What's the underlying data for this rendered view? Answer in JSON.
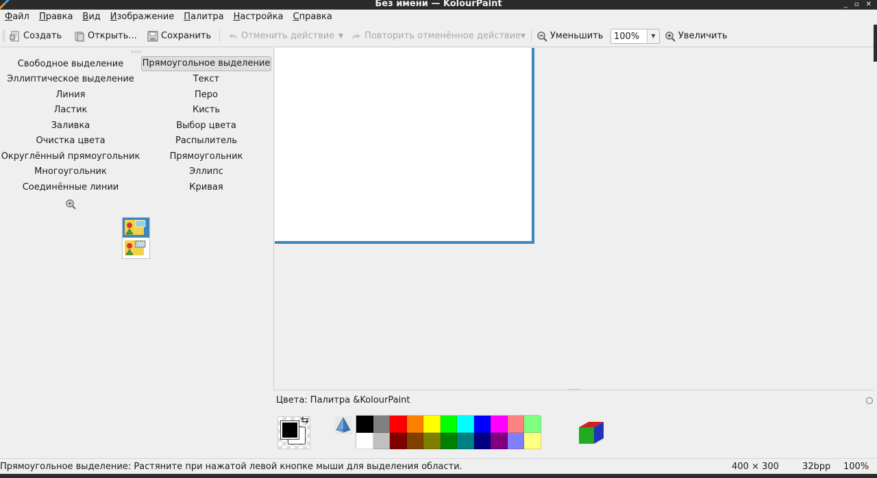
{
  "window": {
    "title": "Без имени  — KolourPaint",
    "buttons": [
      "_",
      "▫",
      "✕"
    ]
  },
  "menubar": [
    {
      "acc": "Ф",
      "rest": "айл"
    },
    {
      "acc": "П",
      "rest": "равка"
    },
    {
      "acc": "В",
      "rest": "ид"
    },
    {
      "acc": "И",
      "rest": "зображение"
    },
    {
      "acc": "П",
      "rest": "алитра"
    },
    {
      "acc": "Н",
      "rest": "астройка"
    },
    {
      "acc": "С",
      "rest": "правка"
    }
  ],
  "toolbar": {
    "new_label": "Создать",
    "open_label": "Открыть...",
    "save_label": "Сохранить",
    "undo_label": "Отменить действие",
    "redo_label": "Повторить отменённое действие",
    "zoom_out_label": "Уменьшить",
    "zoom_value": "100%",
    "zoom_in_label": "Увеличить"
  },
  "tools": {
    "col1": [
      "Свободное выделение",
      "Эллиптическое выделение",
      "Линия",
      "Ластик",
      "Заливка",
      "Очистка цвета",
      "Округлённый прямоугольник",
      "Многоугольник",
      "Соединённые линии"
    ],
    "col2": [
      "Прямоугольное выделение",
      "Текст",
      "Перо",
      "Кисть",
      "Выбор цвета",
      "Распылитель",
      "Прямоугольник",
      "Эллипс",
      "Кривая"
    ],
    "active": "Прямоугольное выделение"
  },
  "palette": {
    "title": "Цвета: Палитра &KolourPaint",
    "foreground": "#000000",
    "background": "#ffffff",
    "row1": [
      "#000000",
      "#808080",
      "#ff0000",
      "#ff8000",
      "#ffff00",
      "#00ff00",
      "#00ffff",
      "#0000ff",
      "#ff00ff",
      "#ff8080",
      "#80ff80"
    ],
    "row2": [
      "#ffffff",
      "#c0c0c0",
      "#800000",
      "#804000",
      "#808000",
      "#008000",
      "#008080",
      "#000080",
      "#800080",
      "#8080ff",
      "#ffff80"
    ]
  },
  "status": {
    "message": "Прямоугольное выделение: Растяните при нажатой левой кнопке мыши для выделения области.",
    "size": "400 × 300",
    "depth": "32bpp",
    "zoom": "100%"
  },
  "colors": {
    "accent": "#3b87be",
    "titlebar": "#2b2b2b",
    "panel": "#efefef"
  }
}
